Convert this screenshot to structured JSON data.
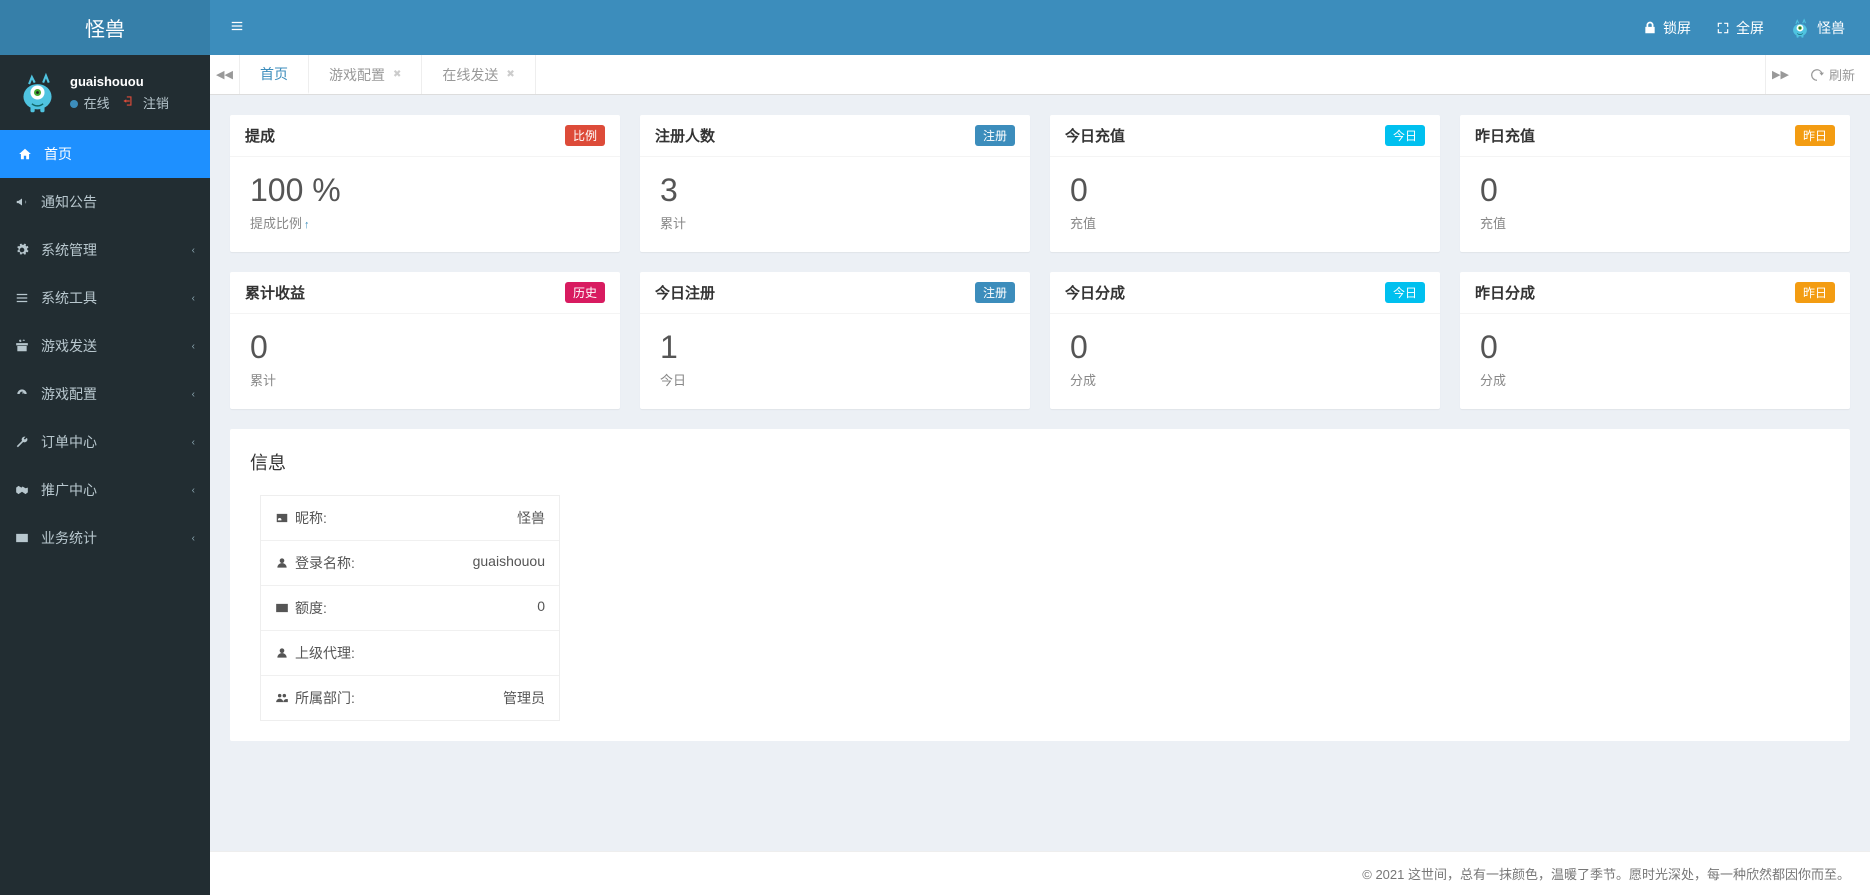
{
  "brand": "怪兽",
  "user": {
    "name": "guaishouou",
    "status": "在线",
    "logout": "注销"
  },
  "nav": [
    {
      "label": "首页",
      "icon": "home"
    },
    {
      "label": "通知公告",
      "icon": "bullhorn"
    },
    {
      "label": "系统管理",
      "icon": "gear"
    },
    {
      "label": "系统工具",
      "icon": "bars"
    },
    {
      "label": "游戏发送",
      "icon": "gift"
    },
    {
      "label": "游戏配置",
      "icon": "dashboard"
    },
    {
      "label": "订单中心",
      "icon": "wrench"
    },
    {
      "label": "推广中心",
      "icon": "handshake"
    },
    {
      "label": "业务统计",
      "icon": "envelope"
    }
  ],
  "topbar": {
    "lock": "锁屏",
    "fullscreen": "全屏",
    "username": "怪兽"
  },
  "tabs": [
    {
      "label": "首页",
      "closable": false,
      "active": true
    },
    {
      "label": "游戏配置",
      "closable": true,
      "active": false
    },
    {
      "label": "在线发送",
      "closable": true,
      "active": false
    }
  ],
  "refresh": "刷新",
  "cards_row1": [
    {
      "title": "提成",
      "badge": "比例",
      "badgeClass": "badge-red",
      "value": "100 %",
      "sub": "提成比例",
      "arrow": true
    },
    {
      "title": "注册人数",
      "badge": "注册",
      "badgeClass": "badge-blue",
      "value": "3",
      "sub": "累计"
    },
    {
      "title": "今日充值",
      "badge": "今日",
      "badgeClass": "badge-teal",
      "value": "0",
      "sub": "充值"
    },
    {
      "title": "昨日充值",
      "badge": "昨日",
      "badgeClass": "badge-orange",
      "value": "0",
      "sub": "充值"
    }
  ],
  "cards_row2": [
    {
      "title": "累计收益",
      "badge": "历史",
      "badgeClass": "badge-pink",
      "value": "0",
      "sub": "累计"
    },
    {
      "title": "今日注册",
      "badge": "注册",
      "badgeClass": "badge-blue",
      "value": "1",
      "sub": "今日"
    },
    {
      "title": "今日分成",
      "badge": "今日",
      "badgeClass": "badge-teal",
      "value": "0",
      "sub": "分成"
    },
    {
      "title": "昨日分成",
      "badge": "昨日",
      "badgeClass": "badge-orange",
      "value": "0",
      "sub": "分成"
    }
  ],
  "info": {
    "heading": "信息",
    "rows": [
      {
        "icon": "id-card",
        "label": "昵称:",
        "value": "怪兽"
      },
      {
        "icon": "user",
        "label": "登录名称:",
        "value": "guaishouou"
      },
      {
        "icon": "credit",
        "label": "额度:",
        "value": "0"
      },
      {
        "icon": "user-o",
        "label": "上级代理:",
        "value": ""
      },
      {
        "icon": "users",
        "label": "所属部门:",
        "value": "管理员"
      }
    ]
  },
  "footer": "© 2021 这世间，总有一抹颜色，温暖了季节。愿时光深处，每一种欣然都因你而至。"
}
